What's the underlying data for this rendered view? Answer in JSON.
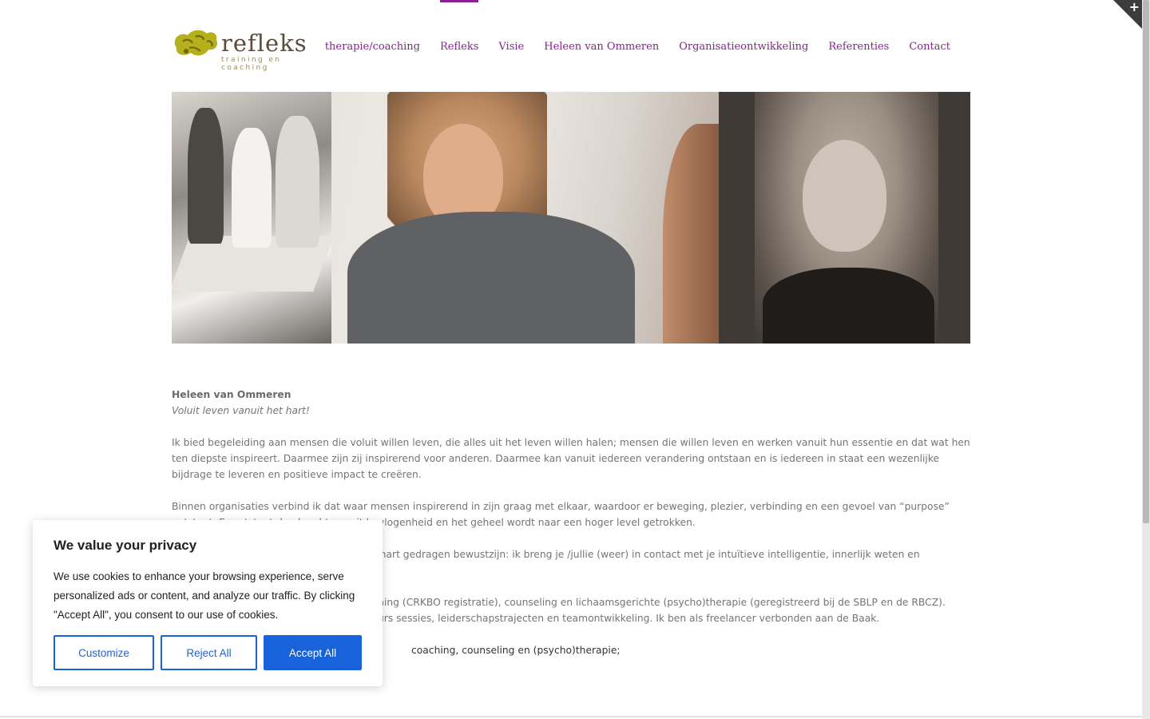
{
  "header": {
    "logo_text": "refleks",
    "logo_subtitle": "training en coaching"
  },
  "nav": {
    "items": [
      {
        "label": "therapie/coaching",
        "active": false
      },
      {
        "label": "Refleks",
        "active": true
      },
      {
        "label": "Visie",
        "active": false
      },
      {
        "label": "Heleen van Ommeren",
        "active": false
      },
      {
        "label": "Organisatieontwikkeling",
        "active": false
      },
      {
        "label": "Referenties",
        "active": false
      },
      {
        "label": "Contact",
        "active": false
      }
    ]
  },
  "corner": {
    "symbol": "+"
  },
  "content": {
    "name": "Heleen van Ommeren",
    "tagline": "Voluit leven vanuit het hart!",
    "p1": "Ik bied begeleiding aan mensen die voluit willen leven, die alles uit het leven willen halen; mensen die willen leven en werken vanuit hun essentie en dat wat hen ten diepste inspireert. Daarmee zijn zij inspirerend voor anderen. Daarmee kan vanuit iedereen verandering ontstaan en is iedereen in staat een wezenlijke bijdrage te leveren en positieve impact te creëren.",
    "p2": "Binnen organisaties verbind ik dat waar mensen inspirerend in zijn graag met elkaar, waardoor er beweging, plezier, verbinding en een gevoel van “purpose” ontstaat. Er ontstaat dan kracht vanuit bevlogenheid en het geheel wordt naar een hoger level getrokken.",
    "p3": "Ik begeleid je in de transitie van ego naar hart gedragen bewustzijn: ik breng je /jullie (weer) in contact met je intuïtieve intelligentie, innerlijk weten en inspiratie.",
    "p4": "Ik werk vanuit (persoonlijk, intuïtive) coaching (CRKBO registratie), counseling en lichaamsgerichte (psycho)therapie (geregistreerd bij de SBLP en de RBCZ). Binnen organisaties begeleid ik o.a. parcours sessies, leiderschapstrajecten en teamontwikkeling. Ik ben als freelancer verbonden aan de Baak.",
    "p5": "coaching, counseling en (psycho)therapie;"
  },
  "cookie": {
    "title": "We value your privacy",
    "text": "We use cookies to enhance your browsing experience, serve personalized ads or content, and analyze our traffic. By clicking \"Accept All\", you consent to our use of cookies.",
    "customize_label": "Customize",
    "reject_label": "Reject All",
    "accept_label": "Accept All"
  },
  "colors": {
    "nav": "#86258d",
    "cookie_button": "#1863dc"
  }
}
